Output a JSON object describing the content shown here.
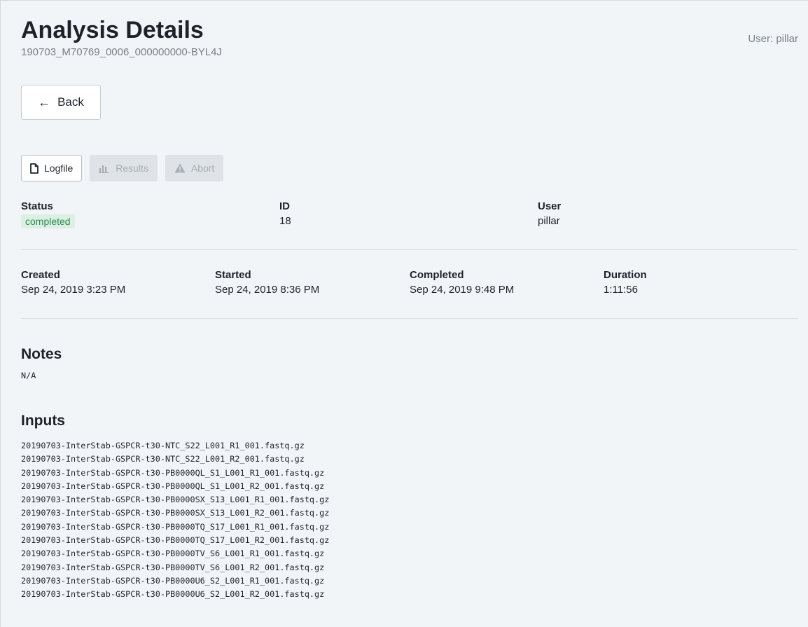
{
  "header": {
    "title": "Analysis Details",
    "subtitle": "190703_M70769_0006_000000000-BYL4J",
    "user_label": "User: pillar"
  },
  "back_button": {
    "arrow": "←",
    "label": "Back"
  },
  "actions": {
    "logfile": "Logfile",
    "results": "Results",
    "abort": "Abort"
  },
  "summary": {
    "status_label": "Status",
    "status_value": "completed",
    "id_label": "ID",
    "id_value": "18",
    "user_label": "User",
    "user_value": "pillar"
  },
  "timing": {
    "created_label": "Created",
    "created_value": "Sep 24, 2019 3:23 PM",
    "started_label": "Started",
    "started_value": "Sep 24, 2019 8:36 PM",
    "completed_label": "Completed",
    "completed_value": "Sep 24, 2019 9:48 PM",
    "duration_label": "Duration",
    "duration_value": "1:11:56"
  },
  "notes": {
    "title": "Notes",
    "value": "N/A"
  },
  "inputs": {
    "title": "Inputs",
    "files": [
      "20190703-InterStab-GSPCR-t30-NTC_S22_L001_R1_001.fastq.gz",
      "20190703-InterStab-GSPCR-t30-NTC_S22_L001_R2_001.fastq.gz",
      "20190703-InterStab-GSPCR-t30-PB0000QL_S1_L001_R1_001.fastq.gz",
      "20190703-InterStab-GSPCR-t30-PB0000QL_S1_L001_R2_001.fastq.gz",
      "20190703-InterStab-GSPCR-t30-PB0000SX_S13_L001_R1_001.fastq.gz",
      "20190703-InterStab-GSPCR-t30-PB0000SX_S13_L001_R2_001.fastq.gz",
      "20190703-InterStab-GSPCR-t30-PB0000TQ_S17_L001_R1_001.fastq.gz",
      "20190703-InterStab-GSPCR-t30-PB0000TQ_S17_L001_R2_001.fastq.gz",
      "20190703-InterStab-GSPCR-t30-PB0000TV_S6_L001_R1_001.fastq.gz",
      "20190703-InterStab-GSPCR-t30-PB0000TV_S6_L001_R2_001.fastq.gz",
      "20190703-InterStab-GSPCR-t30-PB0000U6_S2_L001_R1_001.fastq.gz",
      "20190703-InterStab-GSPCR-t30-PB0000U6_S2_L001_R2_001.fastq.gz"
    ]
  },
  "colors": {
    "background": "#f1f5f8",
    "status_badge_bg": "#dbf0e2",
    "status_badge_text": "#2e8a52",
    "disabled_button": "#dfe3e7"
  },
  "icons": {
    "back": "arrow-left-icon",
    "logfile": "document-icon",
    "results": "bar-chart-icon",
    "abort": "warning-icon"
  }
}
